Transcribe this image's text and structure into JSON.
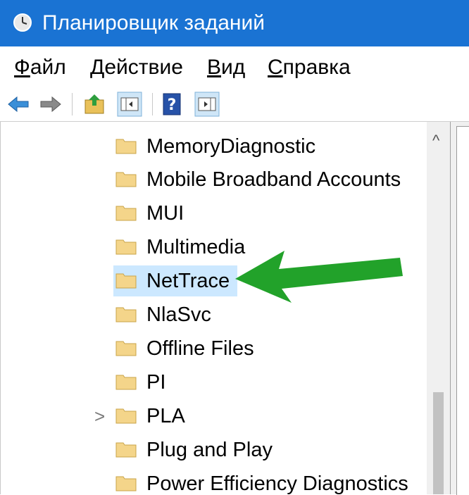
{
  "window": {
    "title": "Планировщик заданий",
    "accent": "#1a73d3"
  },
  "menu": [
    {
      "first": "Ф",
      "rest": "айл"
    },
    {
      "first": "Д",
      "rest": "ействие"
    },
    {
      "first": "В",
      "rest": "ид"
    },
    {
      "first": "С",
      "rest": "правка"
    }
  ],
  "toolbar": {
    "buttons": [
      "back-arrow-icon",
      "forward-arrow-icon",
      "up-folder-icon",
      "show-hide-console-tree-icon",
      "help-icon",
      "show-hide-action-pane-icon"
    ]
  },
  "tree": {
    "items": [
      {
        "label": "MemoryDiagnostic"
      },
      {
        "label": "Mobile Broadband Accounts"
      },
      {
        "label": "MUI"
      },
      {
        "label": "Multimedia"
      },
      {
        "label": "NetTrace",
        "selected": true
      },
      {
        "label": "NlaSvc"
      },
      {
        "label": "Offline Files"
      },
      {
        "label": "PI"
      },
      {
        "label": "PLA",
        "expandable": true
      },
      {
        "label": "Plug and Play"
      },
      {
        "label": "Power Efficiency Diagnostics"
      }
    ],
    "selection_color": "#cce8ff",
    "expander_glyph": ">"
  },
  "scrollbar": {
    "up_glyph": "^"
  },
  "annotation": {
    "arrow_color": "#22a22a"
  }
}
